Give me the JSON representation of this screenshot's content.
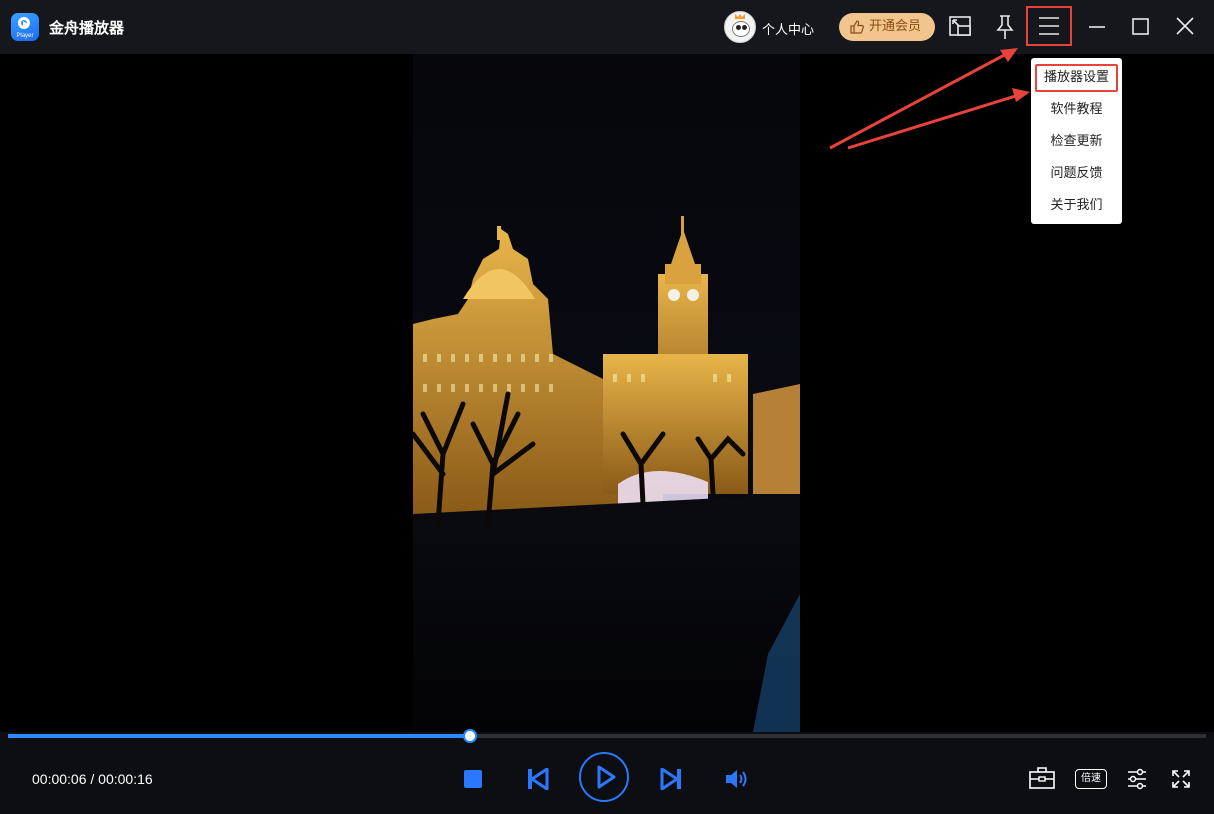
{
  "window": {
    "title": "金舟播放器",
    "logo_text": "Player",
    "user_center_label": "个人中心",
    "vip_label": "开通会员"
  },
  "menu": {
    "items": [
      {
        "label": "播放器设置",
        "highlighted": true
      },
      {
        "label": "软件教程"
      },
      {
        "label": "检查更新"
      },
      {
        "label": "问题反馈"
      },
      {
        "label": "关于我们"
      }
    ]
  },
  "player": {
    "time_display": "00:00:06 / 00:00:16",
    "progress": 0.385,
    "speed_label": "倍速"
  },
  "colors": {
    "accent": "#2b8bff",
    "highlight_box": "#e8433a",
    "vip_bg": "#f1c58d"
  }
}
